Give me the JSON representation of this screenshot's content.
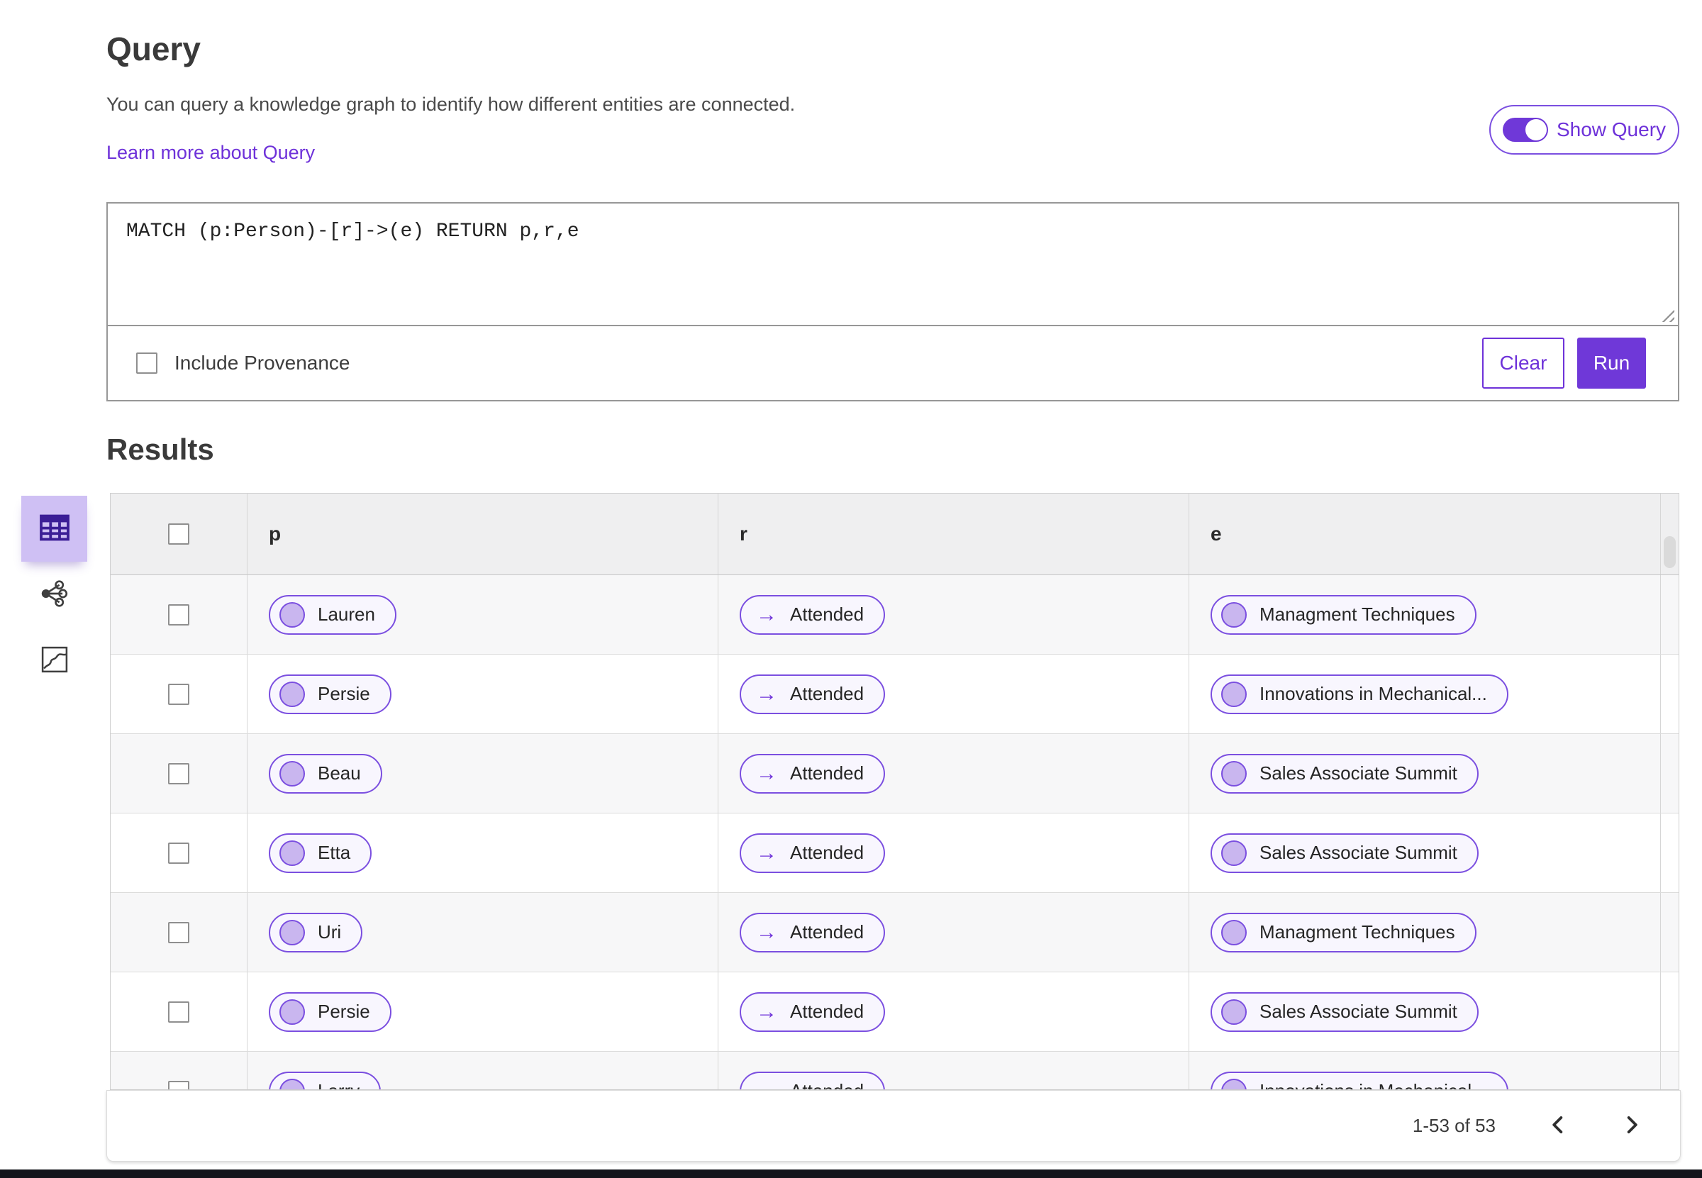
{
  "header": {
    "title": "Query",
    "description": "You can query a knowledge graph to identify how different entities are connected.",
    "learn_more": "Learn more about Query",
    "show_query_label": "Show Query",
    "show_query_on": true
  },
  "query": {
    "text": "MATCH (p:Person)-[r]->(e) RETURN p,r,e",
    "include_provenance_label": "Include Provenance",
    "include_provenance_checked": false,
    "clear_label": "Clear",
    "run_label": "Run"
  },
  "results": {
    "title": "Results"
  },
  "view_switcher": {
    "selected": "table",
    "options": [
      "table-icon",
      "network-graph-icon",
      "map-chart-icon"
    ]
  },
  "table": {
    "columns": [
      "p",
      "r",
      "e"
    ],
    "rows": [
      {
        "p": "Lauren",
        "r": "Attended",
        "e": "Managment Techniques"
      },
      {
        "p": "Persie",
        "r": "Attended",
        "e": "Innovations in Mechanical..."
      },
      {
        "p": "Beau",
        "r": "Attended",
        "e": "Sales Associate Summit"
      },
      {
        "p": "Etta",
        "r": "Attended",
        "e": "Sales Associate Summit"
      },
      {
        "p": "Uri",
        "r": "Attended",
        "e": "Managment Techniques"
      },
      {
        "p": "Persie",
        "r": "Attended",
        "e": "Sales Associate Summit"
      },
      {
        "p": "Larry",
        "r": "Attended",
        "e": "Innovations in Mechanical..."
      }
    ]
  },
  "pagination": {
    "range_label": "1-53 of 53"
  },
  "icons": {
    "relation_arrow": "→",
    "entity_node": "circle-node-icon",
    "toggle": "toggle-on-icon",
    "resize": "resize-grip-icon",
    "chevron_left": "chevron-left-icon",
    "chevron_right": "chevron-right-icon"
  },
  "colors": {
    "accent": "#6E32D9",
    "accent-strong": "#6F38D8",
    "pill-border": "#7B4FE0",
    "pill-bg": "#F8F6FE",
    "node-fill": "#C9B6EF",
    "selected-bg": "#CFC0F4",
    "icon-purple": "#3B1E96"
  }
}
